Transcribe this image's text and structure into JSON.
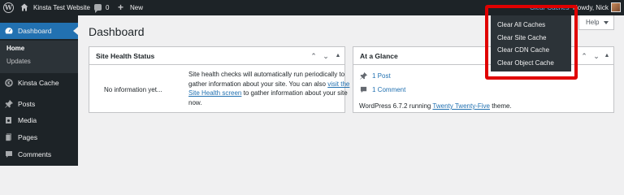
{
  "admin_bar": {
    "site_name": "Kinsta Test Website",
    "comments_count": "0",
    "new_label": "New",
    "clear_caches_label": "Clear Caches",
    "howdy": "Howdy, Nick",
    "wp_logo_icon": "wordpress-logo-icon",
    "home_icon": "home-icon",
    "comments_icon": "comment-bubble-icon",
    "new_icon": "plus-icon"
  },
  "dropdown": {
    "items": [
      {
        "label": "Clear All Caches"
      },
      {
        "label": "Clear Site Cache"
      },
      {
        "label": "Clear CDN Cache"
      },
      {
        "label": "Clear Object Cache"
      }
    ]
  },
  "sidebar": {
    "items": [
      {
        "label": "Dashboard",
        "icon": "dashboard-icon",
        "current": true
      },
      {
        "label": "Kinsta Cache",
        "icon": "kinsta-icon"
      },
      {
        "label": "Posts",
        "icon": "pin-icon"
      },
      {
        "label": "Media",
        "icon": "media-icon"
      },
      {
        "label": "Pages",
        "icon": "pages-icon"
      },
      {
        "label": "Comments",
        "icon": "comments-icon"
      }
    ],
    "submenu": [
      {
        "label": "Home",
        "current": true
      },
      {
        "label": "Updates"
      }
    ]
  },
  "main": {
    "title": "Dashboard",
    "help_label": "Help",
    "site_health": {
      "title": "Site Health Status",
      "empty_label": "No information yet...",
      "text_before_link": "Site health checks will automatically run periodically to gather information about your site. You can also ",
      "link_text": "visit the Site Health screen",
      "text_after_link": " to gather information about your site now."
    },
    "at_a_glance": {
      "title": "At a Glance",
      "posts": "1 Post",
      "comments": "1 Comment",
      "version_prefix": "WordPress 6.7.2 running ",
      "theme_link": "Twenty Twenty-Five",
      "version_suffix": " theme."
    }
  },
  "colors": {
    "admin_bar": "#1d2327",
    "accent": "#2271b1",
    "highlight": "#e00000"
  }
}
